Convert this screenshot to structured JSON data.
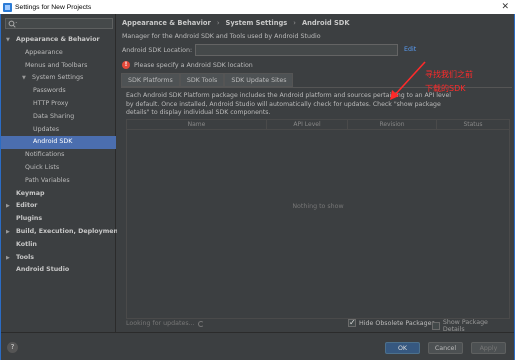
{
  "window": {
    "title": "Settings for New Projects",
    "close": "✕"
  },
  "search": {
    "placeholder": ""
  },
  "tree": [
    {
      "label": "Appearance & Behavior",
      "level": 0,
      "expanded": true,
      "bold": true
    },
    {
      "label": "Appearance",
      "level": 1
    },
    {
      "label": "Menus and Toolbars",
      "level": 1
    },
    {
      "label": "System Settings",
      "level": 1,
      "expanded": true
    },
    {
      "label": "Passwords",
      "level": 2
    },
    {
      "label": "HTTP Proxy",
      "level": 2
    },
    {
      "label": "Data Sharing",
      "level": 2
    },
    {
      "label": "Updates",
      "level": 2
    },
    {
      "label": "Android SDK",
      "level": 2,
      "selected": true
    },
    {
      "label": "Notifications",
      "level": 1
    },
    {
      "label": "Quick Lists",
      "level": 1
    },
    {
      "label": "Path Variables",
      "level": 1
    },
    {
      "label": "Keymap",
      "level": 0,
      "bold": true
    },
    {
      "label": "Editor",
      "level": 0,
      "collapsed": true,
      "bold": true
    },
    {
      "label": "Plugins",
      "level": 0,
      "bold": true
    },
    {
      "label": "Build, Execution, Deployment",
      "level": 0,
      "collapsed": true,
      "bold": true
    },
    {
      "label": "Kotlin",
      "level": 0,
      "bold": true
    },
    {
      "label": "Tools",
      "level": 0,
      "collapsed": true,
      "bold": true
    },
    {
      "label": "Android Studio",
      "level": 0,
      "bold": true
    }
  ],
  "breadcrumb": {
    "part1": "Appearance & Behavior",
    "sep1": "›",
    "part2": "System Settings",
    "sep2": "›",
    "part3": "Android SDK"
  },
  "main": {
    "description": "Manager for the Android SDK and Tools used by Android Studio",
    "location_label": "Android SDK Location:",
    "location_value": "",
    "edit_link": "Edit",
    "warning": "Please specify a Android SDK location",
    "warning_icon": "!",
    "tabs": [
      "SDK Platforms",
      "SDK Tools",
      "SDK Update Sites"
    ],
    "panel_description": "Each Android SDK Platform package includes the Android platform and sources pertaining to an API level by default. Once installed, Android Studio will automatically check for updates. Check \"show package details\" to display individual SDK components.",
    "columns": [
      "Name",
      "API Level",
      "Revision",
      "Status"
    ],
    "empty_text": "Nothing to show",
    "looking_text": "Looking for updates...",
    "hide_obsolete": {
      "label": "Hide Obsolete Packages",
      "checked": true
    },
    "show_details": {
      "label": "Show Package Details",
      "checked": false
    }
  },
  "footer": {
    "help": "?",
    "ok": "OK",
    "cancel": "Cancel",
    "apply": "Apply"
  },
  "annotation": {
    "line1": "寻找我们之前",
    "line2": "下载的SDK",
    "color": "#ff2a2a"
  },
  "colors": {
    "selection": "#4b6eaf",
    "background": "#3c3f41",
    "link": "#589df6",
    "warning": "#e5493a"
  }
}
